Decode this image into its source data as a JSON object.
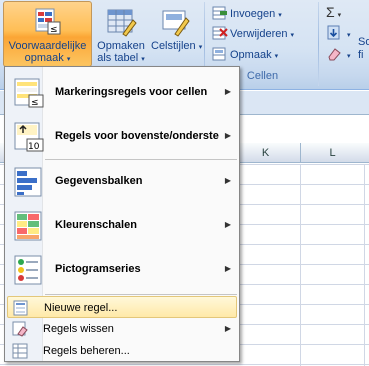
{
  "ribbon": {
    "conditional_formatting": {
      "line1": "Voorwaardelijke",
      "line2": "opmaak"
    },
    "format_as_table": {
      "line1": "Opmaken",
      "line2": "als tabel"
    },
    "cell_styles": {
      "line1": "Celstijlen"
    },
    "cells_group": {
      "insert": "Invoegen",
      "delete": "Verwijderen",
      "format": "Opmaak",
      "label": "Cellen"
    },
    "editing_group": {
      "sum_symbol": "Σ",
      "sort_partial_1": "So",
      "sort_partial_2": "fi"
    },
    "dropdown_arrow": "▾"
  },
  "sheet": {
    "column_headers": [
      "K",
      "L"
    ]
  },
  "menu": {
    "items": [
      {
        "label": "Markeringsregels voor cellen",
        "icon": "highlight-cells-rules-icon",
        "submenu": true
      },
      {
        "label": "Regels voor bovenste/onderste",
        "icon": "top-bottom-rules-icon",
        "submenu": true
      },
      {
        "label": "Gegevensbalken",
        "icon": "data-bars-icon",
        "submenu": true
      },
      {
        "label": "Kleurenschalen",
        "icon": "color-scales-icon",
        "submenu": true
      },
      {
        "label": "Pictogramseries",
        "icon": "icon-sets-icon",
        "submenu": true
      },
      {
        "label": "Nieuwe regel...",
        "icon": "new-rule-icon",
        "submenu": false,
        "highlighted": true
      },
      {
        "label": "Regels wissen",
        "icon": "clear-rules-icon",
        "submenu": true
      },
      {
        "label": "Regels beheren...",
        "icon": "manage-rules-icon",
        "submenu": false
      }
    ],
    "submenu_arrow": "▶"
  },
  "colors": {
    "ribbon_bg": "#d5e3f3",
    "active_button": "#fba535",
    "menu_highlight": "#ffe9a8",
    "text_blue": "#15428b"
  }
}
